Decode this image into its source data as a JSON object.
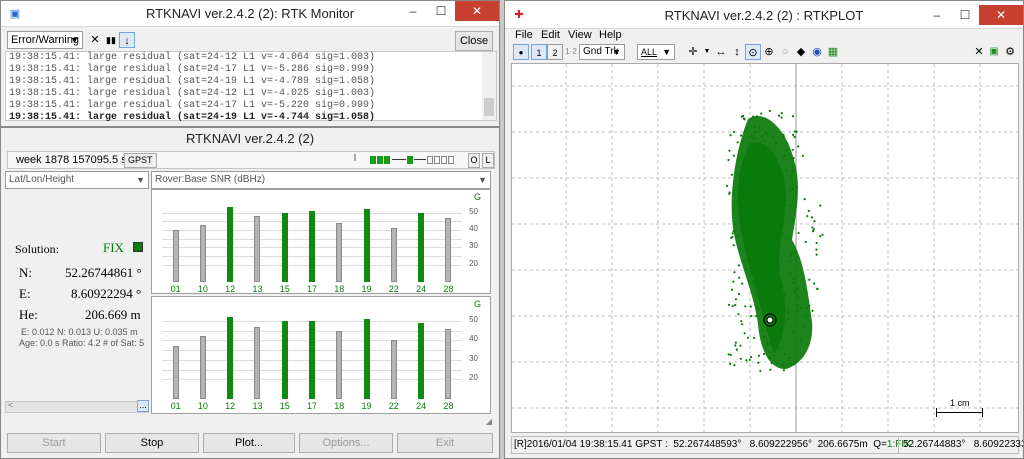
{
  "monitor": {
    "title": "RTKNAVI ver.2.4.2 (2): RTK Monitor",
    "filter_value": "Error/Warning",
    "close_label": "Close",
    "log_lines": [
      "19:38:15.41: large residual (sat=24-12 L1 v=-4.064 sig=1.003)",
      "19:38:15.41: large residual (sat=24-17 L1 v=-5.286 sig=0.999)",
      "19:38:15.41: large residual (sat=24-19 L1 v=-4.789 sig=1.058)",
      "19:38:15.41: large residual (sat=24-12 L1 v=-4.025 sig=1.003)",
      "19:38:15.41: large residual (sat=24-17 L1 v=-5.220 sig=0.999)",
      "19:38:15.41: large residual (sat=24-19 L1 v=-4.744 sig=1.058)"
    ]
  },
  "rtknavi": {
    "title": "RTKNAVI ver.2.4.2 (2)",
    "time": "week 1878 157095.5 s",
    "timesys": "GPST",
    "btn_i": "I",
    "btn_o": "O",
    "btn_l": "L",
    "left_combo": "Lat/Lon/Height",
    "right_combo": "Rover:Base SNR (dBHz)",
    "solution_label": "Solution:",
    "solution_value": "FIX",
    "n_label": "N:",
    "n_value": "52.26744861 °",
    "e_label": "E:",
    "e_value": "8.60922294 °",
    "he_label": "He:",
    "he_value": "206.669 m",
    "stats1": "E: 0.012 N: 0.013 U: 0.035 m",
    "stats2": "Age: 0.0 s Ratio: 4.2 # of Sat: 5",
    "more_btn": "...",
    "buttons": {
      "start": "Start",
      "stop": "Stop",
      "plot": "Plot...",
      "options": "Options...",
      "exit": "Exit"
    }
  },
  "chart_data": [
    {
      "type": "bar",
      "label": "G",
      "categories": [
        "01",
        "10",
        "12",
        "13",
        "15",
        "17",
        "18",
        "19",
        "22",
        "24",
        "28"
      ],
      "values": [
        40,
        43,
        53,
        48,
        50,
        51,
        44,
        52,
        41,
        50,
        47
      ],
      "highlighted": [
        false,
        false,
        true,
        false,
        true,
        true,
        false,
        true,
        false,
        true,
        false
      ],
      "yticks": [
        20,
        25,
        30,
        35,
        40,
        45,
        50
      ],
      "ylim": [
        10,
        55
      ]
    },
    {
      "type": "bar",
      "label": "G",
      "categories": [
        "01",
        "10",
        "12",
        "13",
        "15",
        "17",
        "18",
        "19",
        "22",
        "24",
        "28"
      ],
      "values": [
        37,
        42,
        52,
        47,
        50,
        50,
        45,
        51,
        40,
        49,
        46
      ],
      "highlighted": [
        false,
        false,
        true,
        false,
        true,
        true,
        false,
        true,
        false,
        true,
        false
      ],
      "yticks": [
        20,
        25,
        30,
        35,
        40,
        45,
        50
      ],
      "ylim": [
        10,
        55
      ]
    }
  ],
  "rtkplot": {
    "title": "RTKNAVI ver.2.4.2 (2) : RTKPLOT",
    "menu": [
      "File",
      "Edit",
      "View",
      "Help"
    ],
    "plot_type": "Gnd Trk",
    "sat_filter": "ALL",
    "scale_label": "1 cm",
    "status_left": "[R]2016/01/04 19:38:15.41 GPST :  52.267448593°   8.609222956°  206.6675m  Q=",
    "status_q": "1:FIX",
    "status_right": "52.26744883°   8.60922333°",
    "colors": {
      "fix": "#0a7a0a",
      "grid": "#bdbdbd"
    }
  }
}
